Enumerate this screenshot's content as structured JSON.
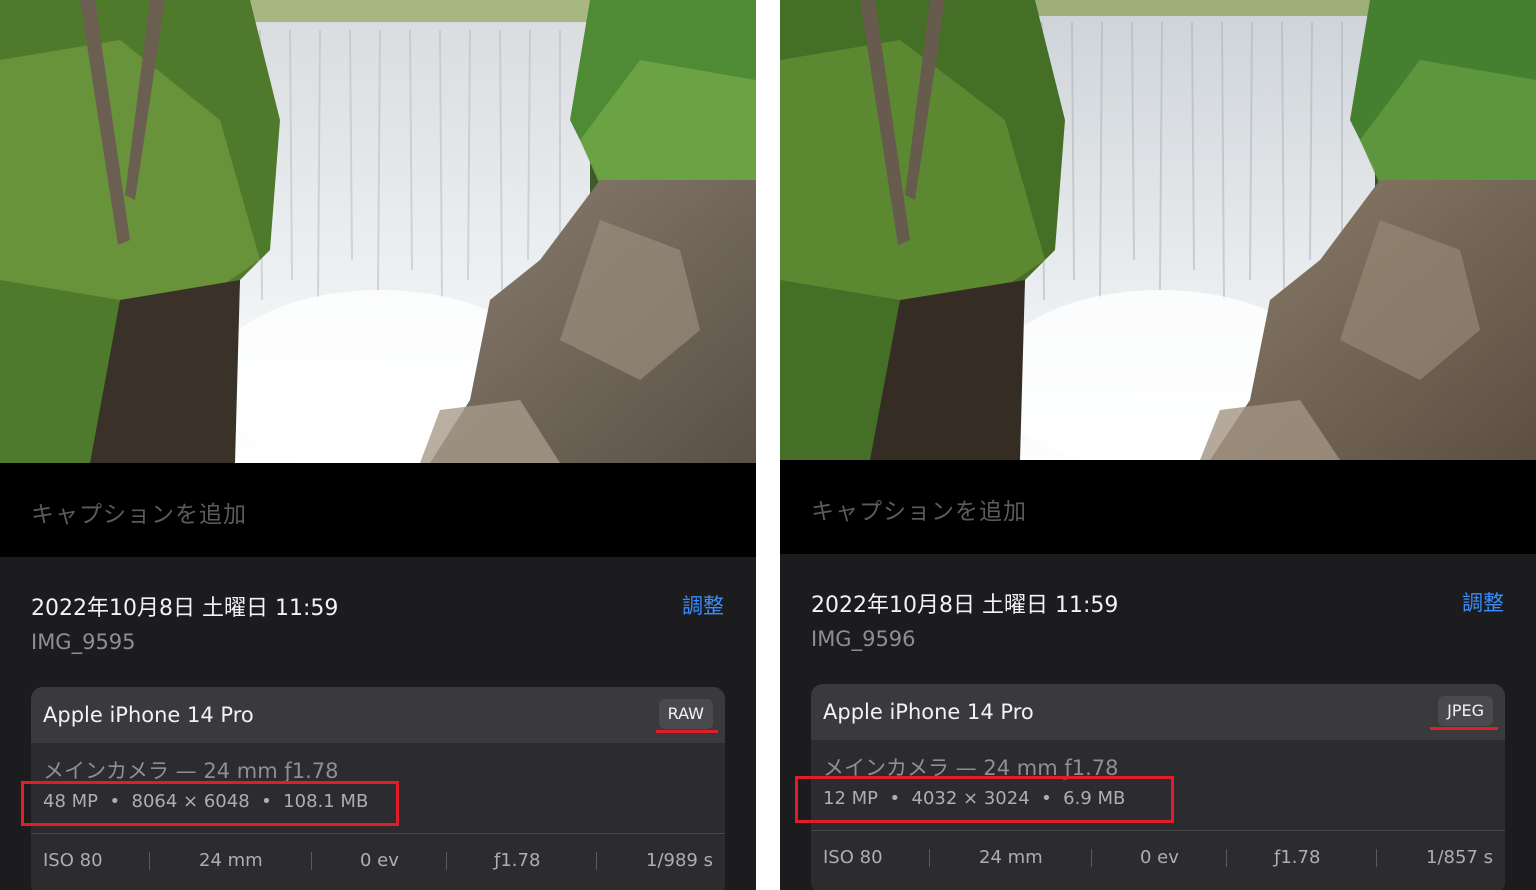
{
  "left": {
    "caption_placeholder": "キャプションを追加",
    "date": "2022年10月8日 土曜日 11:59",
    "adjust_label": "調整",
    "filename": "IMG_9595",
    "device": "Apple iPhone 14 Pro",
    "format": "RAW",
    "lens": "メインカメラ — 24 mm ƒ1.78",
    "specs": "48 MP  •  8064 × 6048  •  108.1 MB",
    "exif": [
      "ISO 80",
      "24 mm",
      "0 ev",
      "ƒ1.78",
      "1/989 s"
    ]
  },
  "right": {
    "caption_placeholder": "キャプションを追加",
    "date": "2022年10月8日 土曜日 11:59",
    "adjust_label": "調整",
    "filename": "IMG_9596",
    "device": "Apple iPhone 14 Pro",
    "format": "JPEG",
    "lens": "メインカメラ — 24 mm ƒ1.78",
    "specs": "12 MP  •  4032 × 3024  •  6.9 MB",
    "exif": [
      "ISO 80",
      "24 mm",
      "0 ev",
      "ƒ1.78",
      "1/857 s"
    ]
  },
  "colors": {
    "highlight": "#e11d2a",
    "link": "#3a8dfa",
    "background": "#1c1c1e"
  }
}
